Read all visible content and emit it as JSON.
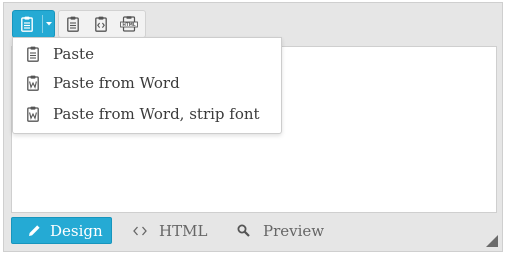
{
  "toolbar": {
    "paste_icon": "clipboard-icon",
    "dropdown_icon": "caret-down-icon",
    "tools": [
      "paste-text-icon",
      "paste-html-icon",
      "paste-clean-icon"
    ]
  },
  "paste_menu": {
    "items": [
      {
        "label": "Paste",
        "icon": "clipboard-icon"
      },
      {
        "label": "Paste from Word",
        "icon": "word-clipboard-icon"
      },
      {
        "label": "Paste from Word, strip font",
        "icon": "word-clipboard-icon"
      }
    ]
  },
  "modes": {
    "design": "Design",
    "html": "HTML",
    "preview": "Preview",
    "active": "Design"
  },
  "colors": {
    "accent": "#25aad4",
    "toolbar_bg": "#e6e6e6"
  }
}
